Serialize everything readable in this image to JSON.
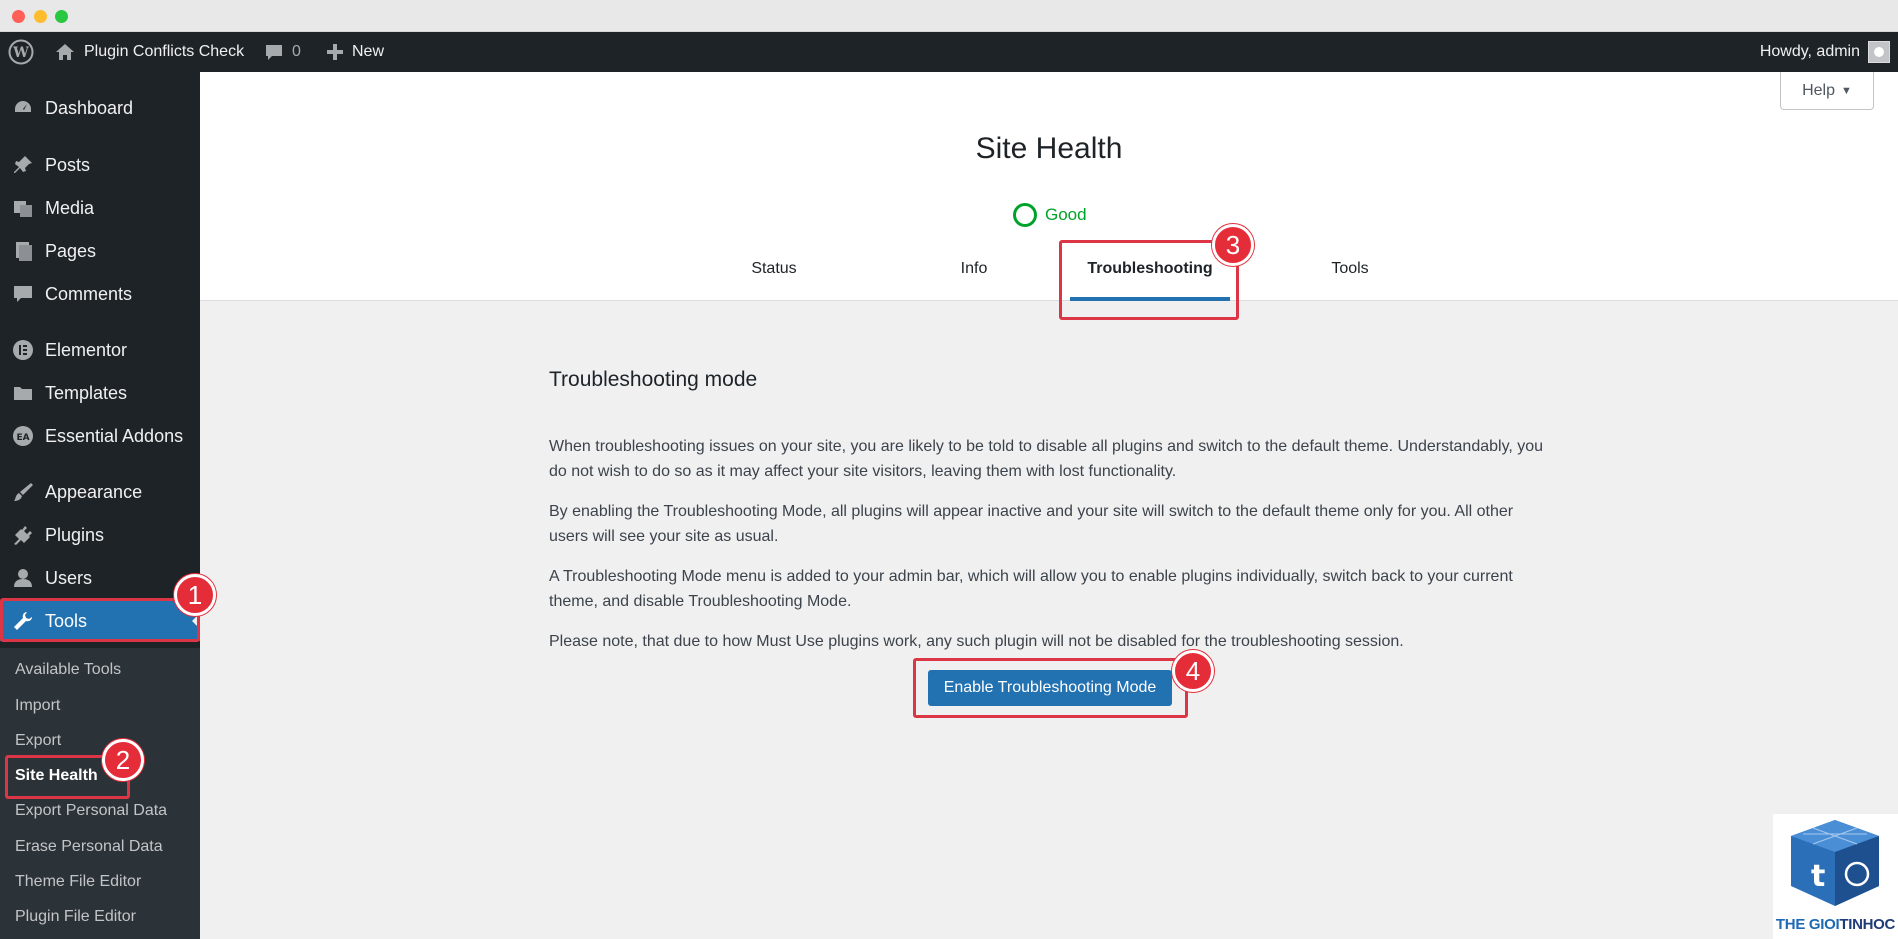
{
  "window": {
    "controls": [
      "close",
      "minimize",
      "zoom"
    ]
  },
  "adminbar": {
    "site_name": "Plugin Conflicts Check",
    "comments_count": "0",
    "new_label": "New",
    "howdy": "Howdy, admin"
  },
  "sidebar": {
    "items": [
      {
        "label": "Dashboard",
        "icon": "dashboard-icon"
      },
      {
        "label": "Posts",
        "icon": "pin-icon"
      },
      {
        "label": "Media",
        "icon": "media-icon"
      },
      {
        "label": "Pages",
        "icon": "pages-icon"
      },
      {
        "label": "Comments",
        "icon": "comment-icon"
      },
      {
        "label": "Elementor",
        "icon": "elementor-icon"
      },
      {
        "label": "Templates",
        "icon": "folder-icon"
      },
      {
        "label": "Essential Addons",
        "icon": "ea-icon"
      },
      {
        "label": "Appearance",
        "icon": "brush-icon"
      },
      {
        "label": "Plugins",
        "icon": "plug-icon"
      },
      {
        "label": "Users",
        "icon": "user-icon"
      },
      {
        "label": "Tools",
        "icon": "wrench-icon"
      }
    ],
    "active": "Tools",
    "submenu": [
      {
        "label": "Available Tools"
      },
      {
        "label": "Import"
      },
      {
        "label": "Export"
      },
      {
        "label": "Site Health"
      },
      {
        "label": "Export Personal Data"
      },
      {
        "label": "Erase Personal Data"
      },
      {
        "label": "Theme File Editor"
      },
      {
        "label": "Plugin File Editor"
      }
    ],
    "current_submenu": "Site Health"
  },
  "header": {
    "help_label": "Help",
    "title": "Site Health",
    "status_label": "Good",
    "tabs": [
      {
        "label": "Status"
      },
      {
        "label": "Info"
      },
      {
        "label": "Troubleshooting"
      },
      {
        "label": "Tools"
      }
    ],
    "active_tab": "Troubleshooting"
  },
  "main": {
    "section_title": "Troubleshooting mode",
    "paragraphs": [
      "When troubleshooting issues on your site, you are likely to be told to disable all plugins and switch to the default theme. Understandably, you do not wish to do so as it may affect your site visitors, leaving them with lost functionality.",
      "By enabling the Troubleshooting Mode, all plugins will appear inactive and your site will switch to the default theme only for you. All other users will see your site as usual.",
      "A Troubleshooting Mode menu is added to your admin bar, which will allow you to enable plugins individually, switch back to your current theme, and disable Troubleshooting Mode.",
      "Please note, that due to how Must Use plugins work, any such plugin will not be disabled for the troubleshooting session."
    ],
    "button_label": "Enable Troubleshooting Mode"
  },
  "annotations": [
    "1",
    "2",
    "3",
    "4"
  ],
  "watermark": {
    "part1": "THE GIOI",
    "part2": "TINHOC"
  },
  "colors": {
    "admin_dark": "#1d2327",
    "submenu_bg": "#2c3338",
    "primary": "#2271b1",
    "good": "#00a32a",
    "annotation_red": "#e52d3a"
  }
}
